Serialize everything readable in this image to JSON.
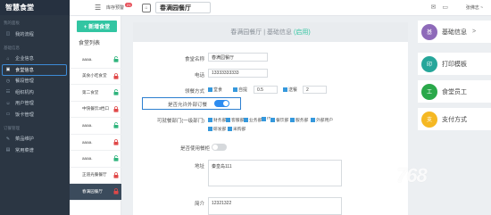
{
  "sidebar": {
    "brand": "智慧食堂",
    "sections": [
      {
        "title": "我的面板",
        "items": [
          {
            "label": "我的流程",
            "icon": "dashboard-icon"
          }
        ]
      },
      {
        "title": "基础信息",
        "items": [
          {
            "label": "企业信息",
            "icon": "home-icon"
          },
          {
            "label": "食堂信息",
            "icon": "restaurant-icon",
            "active": true
          },
          {
            "label": "餐段管理",
            "icon": "clock-icon"
          },
          {
            "label": "组织机构",
            "icon": "org-icon"
          },
          {
            "label": "用户管理",
            "icon": "user-icon"
          },
          {
            "label": "饭卡管理",
            "icon": "card-icon"
          }
        ]
      },
      {
        "title": "订餐管理",
        "items": [
          {
            "label": "菜品维护",
            "icon": "dish-icon"
          },
          {
            "label": "常用菜谱",
            "icon": "book-icon"
          }
        ]
      }
    ]
  },
  "topbar": {
    "cashier": "库存预警",
    "cashier_badge": "21",
    "store_name": "春满园餐厅",
    "user": "张佛志 ~"
  },
  "canteen": {
    "new_button": "+ 新增食堂",
    "list_title": "食堂列表",
    "rows": [
      {
        "name": "aaaa.",
        "lock": "open"
      },
      {
        "name": "美食小吃食堂",
        "lock": "closed"
      },
      {
        "name": "第二食堂",
        "lock": "open"
      },
      {
        "name": "中快餐饮3档口",
        "lock": "closed"
      },
      {
        "name": "aaaa.",
        "lock": "open"
      },
      {
        "name": "aaaa.",
        "lock": "closed"
      },
      {
        "name": "aaaa.",
        "lock": "open"
      },
      {
        "name": "正道光餐餐厅",
        "lock": "closed"
      },
      {
        "name": "春满园餐厅",
        "lock": "closed",
        "active": true
      }
    ]
  },
  "form": {
    "header": "春满园餐厅 | 基础信息",
    "header_status": "(启用)",
    "name_label": "食堂名称",
    "name_value": "春满园餐厅",
    "phone_label": "电话",
    "phone_value": "13333333333",
    "meal_label": "领餐方式",
    "meal_opt1": "堂食",
    "meal_opt2": "自提",
    "meal_opt2_value": "0.5",
    "meal_opt3": "送餐",
    "meal_opt3_value": "2",
    "outside_label": "是否允许外部订餐",
    "dept_label": "可就餐部门(一级部门)",
    "depts": [
      "财务部",
      "客服部",
      "业务部",
      "IT",
      "餐饮部",
      "服务部",
      "外部用户",
      "研发部",
      "采购部"
    ],
    "box_label": "是否使用餐柜",
    "address_label": "地址",
    "address_value": "秦皇岛111",
    "intro_label": "简介",
    "intro_value": "12321322"
  },
  "right_nav": [
    {
      "circle": "基",
      "label": "基础信息",
      "color": "#8e6ab9",
      "arrow": ">"
    },
    {
      "circle": "印",
      "label": "打印模板",
      "color": "#26a69a",
      "arrow": ""
    },
    {
      "circle": "工",
      "label": "食堂员工",
      "color": "#2aa84a",
      "arrow": ""
    },
    {
      "circle": "支",
      "label": "支付方式",
      "color": "#f5b823",
      "arrow": ""
    }
  ],
  "watermark": "768"
}
